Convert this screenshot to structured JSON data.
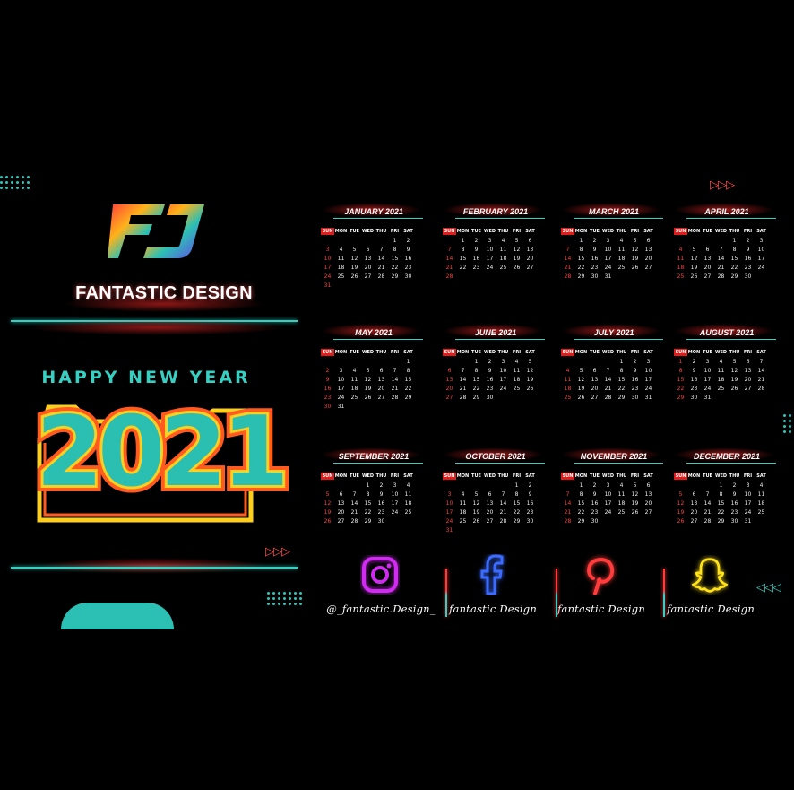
{
  "brand": {
    "name": "FANTASTIC DESIGN",
    "logo_icon": "fd-logo-icon",
    "greeting": "HAPPY NEW YEAR",
    "year": "2021"
  },
  "colors": {
    "background": "#000000",
    "accent_teal": "#36cfc2",
    "accent_red": "#e21b1b",
    "accent_yellow": "#ffcf1f",
    "accent_orange": "#ff5a1f"
  },
  "weekdays": [
    "SUN",
    "MON",
    "TUE",
    "WED",
    "THU",
    "FRI",
    "SAT"
  ],
  "months": [
    {
      "title": "JANUARY 2021",
      "start": 5,
      "days": 31
    },
    {
      "title": "FEBRUARY 2021",
      "start": 1,
      "days": 28
    },
    {
      "title": "MARCH 2021",
      "start": 1,
      "days": 31
    },
    {
      "title": "APRIL 2021",
      "start": 4,
      "days": 30
    },
    {
      "title": "MAY 2021",
      "start": 6,
      "days": 31
    },
    {
      "title": "JUNE 2021",
      "start": 2,
      "days": 30
    },
    {
      "title": "JULY 2021",
      "start": 4,
      "days": 31
    },
    {
      "title": "AUGUST 2021",
      "start": 0,
      "days": 31
    },
    {
      "title": "SEPTEMBER 2021",
      "start": 3,
      "days": 30
    },
    {
      "title": "OCTOBER 2021",
      "start": 5,
      "days": 31
    },
    {
      "title": "NOVEMBER 2021",
      "start": 1,
      "days": 30
    },
    {
      "title": "DECEMBER 2021",
      "start": 3,
      "days": 31
    }
  ],
  "social": [
    {
      "icon": "instagram-icon",
      "handle": "@_fantastic.Design_",
      "color": "#d02bf0"
    },
    {
      "icon": "facebook-icon",
      "handle": "fantastic Design",
      "color": "#3b6bff"
    },
    {
      "icon": "pinterest-icon",
      "handle": "fantastic Design",
      "color": "#ff3b3b"
    },
    {
      "icon": "snapchat-icon",
      "handle": "fantastic Design",
      "color": "#ffe21a"
    }
  ]
}
